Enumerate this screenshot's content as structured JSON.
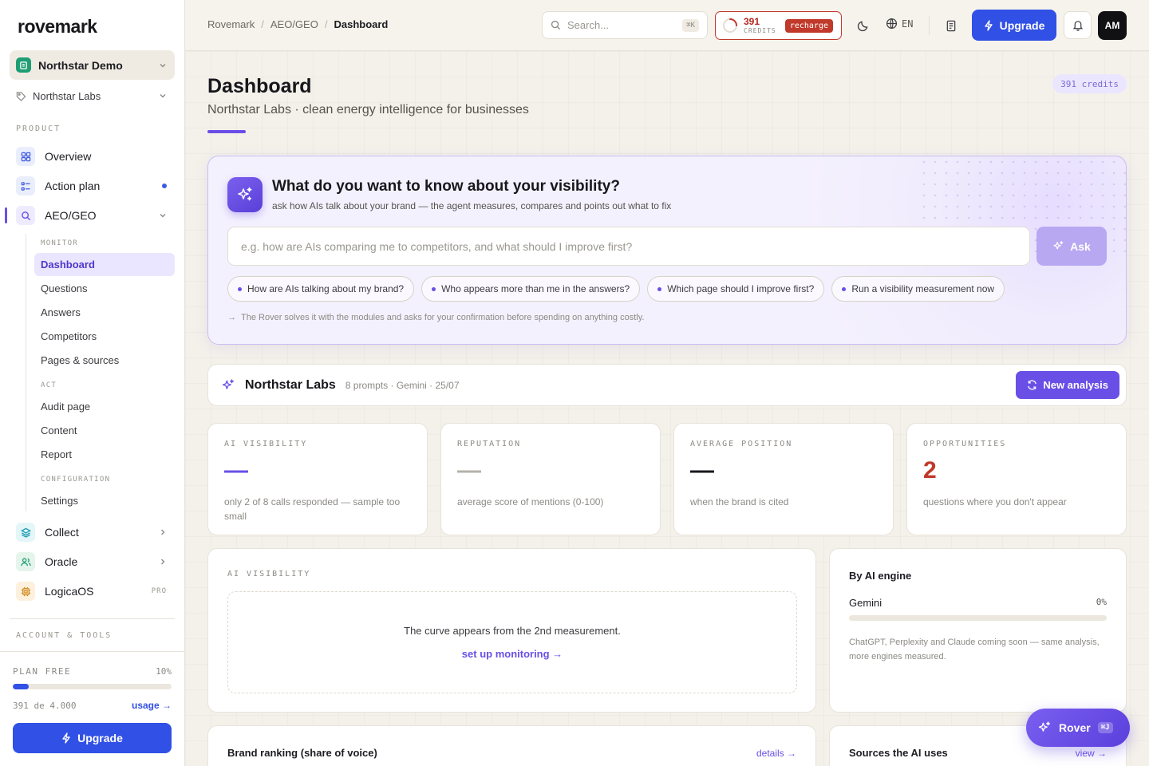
{
  "app": {
    "logo": "rovemark"
  },
  "sidebar": {
    "workspace": "Northstar Demo",
    "brand": "Northstar Labs",
    "product_title": "PRODUCT",
    "items": [
      {
        "label": "Overview",
        "icon": "grid-icon"
      },
      {
        "label": "Action plan",
        "icon": "list-icon"
      },
      {
        "label": "AEO/GEO",
        "icon": "search-icon"
      }
    ],
    "monitor_title": "MONITOR",
    "monitor_items": [
      "Dashboard",
      "Questions",
      "Answers",
      "Competitors",
      "Pages & sources"
    ],
    "act_title": "ACT",
    "act_items": [
      "Audit page",
      "Content",
      "Report"
    ],
    "config_title": "CONFIGURATION",
    "config_items": [
      "Settings"
    ],
    "more_items": [
      {
        "label": "Collect",
        "icon": "layers-icon"
      },
      {
        "label": "Oracle",
        "icon": "users-icon"
      },
      {
        "label": "LogicaOS",
        "icon": "chip-icon",
        "tag": "PRO"
      }
    ],
    "account_title": "ACCOUNT & TOOLS",
    "plan": {
      "label": "PLAN FREE",
      "percent_label": "10%",
      "percent": 10,
      "count": "391 de 4.000",
      "usage_link": "usage →"
    },
    "upgrade": "Upgrade"
  },
  "topbar": {
    "breadcrumbs": [
      "Rovemark",
      "AEO/GEO",
      "Dashboard"
    ],
    "search_placeholder": "Search...",
    "search_kbd": "⌘K",
    "credits": "391",
    "credits_label": "CREDITS",
    "recharge": "recharge",
    "lang": "EN",
    "upgrade": "Upgrade",
    "avatar": "AM"
  },
  "page": {
    "title": "Dashboard",
    "subtitle": "Northstar Labs · clean energy intelligence for businesses",
    "credits_badge": "391 credits"
  },
  "ask": {
    "title": "What do you want to know about your visibility?",
    "subtitle": "ask how AIs talk about your brand — the agent measures, compares and points out what to fix",
    "placeholder": "e.g. how are AIs comparing me to competitors, and what should I improve first?",
    "button": "Ask",
    "chips": [
      "How are AIs talking about my brand?",
      "Who appears more than me in the answers?",
      "Which page should I improve first?",
      "Run a visibility measurement now"
    ],
    "note": "The Rover solves it with the modules and asks for your confirmation before spending on anything costly."
  },
  "brand_bar": {
    "name": "Northstar Labs",
    "meta": "8 prompts · Gemini · 25/07",
    "button": "New analysis"
  },
  "kpis": [
    {
      "label": "AI VISIBILITY",
      "value": "—",
      "desc": "only 2 of 8 calls responded — sample too small",
      "color": "#6a4fe6"
    },
    {
      "label": "REPUTATION",
      "value": "—",
      "desc": "average score of mentions (0-100)",
      "color": "#b4b1aa"
    },
    {
      "label": "AVERAGE POSITION",
      "value": "—",
      "desc": "when the brand is cited",
      "color": "#17171c"
    },
    {
      "label": "OPPORTUNITIES",
      "value": "2",
      "desc": "questions where you don't appear",
      "color": "#c0392b"
    }
  ],
  "visibility": {
    "label": "AI VISIBILITY",
    "empty_text": "The curve appears from the 2nd measurement.",
    "link": "set up monitoring →"
  },
  "engines": {
    "title": "By AI engine",
    "rows": [
      {
        "name": "Gemini",
        "percent_label": "0%",
        "percent": 0
      }
    ],
    "note": "ChatGPT, Perplexity and Claude coming soon — same analysis, more engines measured."
  },
  "ranking": {
    "title": "Brand ranking (share of voice)",
    "link": "details →"
  },
  "sources": {
    "title": "Sources the AI uses",
    "link": "view →"
  },
  "rover": {
    "label": "Rover",
    "kbd": "⌘J"
  }
}
